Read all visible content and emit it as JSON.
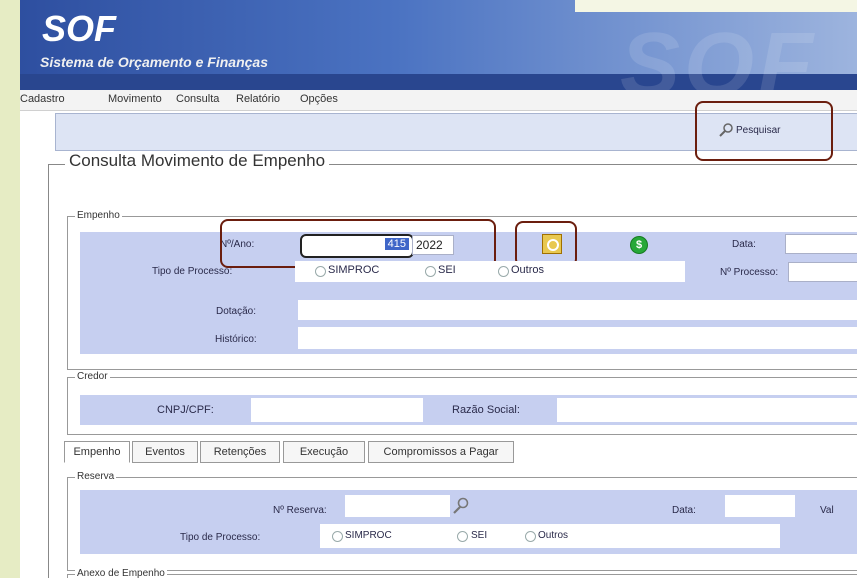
{
  "app": {
    "logo": "SOF",
    "subtitle": "Sistema de Orçamento e Finanças"
  },
  "menu": [
    "Cadastro",
    "Movimento",
    "Consulta",
    "Relatório",
    "Opções"
  ],
  "toolbar": {
    "search_label": "Pesquisar"
  },
  "page": {
    "title": "Consulta Movimento de Empenho"
  },
  "empenho_group": {
    "title": "Empenho",
    "nro_ano_label": "Nº/Ano:",
    "nro_value": "415",
    "ano_value": "2022",
    "data_label": "Data:",
    "tipo_processo_label": "Tipo de Processo:",
    "tipo_options": [
      "SIMPROC",
      "SEI",
      "Outros"
    ],
    "n_processo_label": "Nº Processo:",
    "dotacao_label": "Dotação:",
    "historico_label": "Histórico:"
  },
  "credor_group": {
    "title": "Credor",
    "cnpj_label": "CNPJ/CPF:",
    "razao_label": "Razão Social:"
  },
  "tabs": [
    "Empenho",
    "Eventos",
    "Retenções",
    "Execução",
    "Compromissos a Pagar"
  ],
  "reserva_group": {
    "title": "Reserva",
    "n_reserva_label": "Nº Reserva:",
    "data_label": "Data:",
    "valor_label": "Val",
    "tipo_processo_label": "Tipo de Processo:",
    "tipo_options": [
      "SIMPROC",
      "SEI",
      "Outros"
    ]
  },
  "anexo_group": {
    "title": "Anexo de Empenho"
  },
  "colors": {
    "accent": "#6b1e0e",
    "panel": "#c6cff0",
    "banner": "#3a5cad"
  }
}
